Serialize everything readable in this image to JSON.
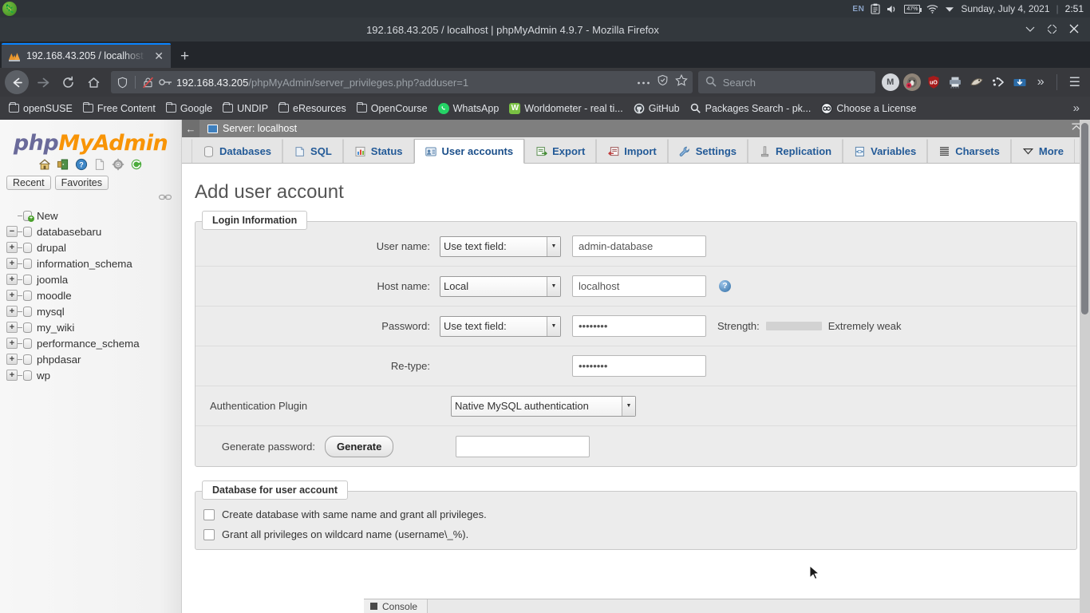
{
  "os_panel": {
    "logo": "opensuse-logo",
    "tray": {
      "keyboard_language": "EN",
      "icons": [
        "clipboard-icon",
        "volume-icon",
        "battery-icon",
        "wifi-icon",
        "dropdown-arrow-icon"
      ],
      "battery_percent": "47%",
      "date": "Sunday, July 4, 2021",
      "time": "2:51"
    }
  },
  "browser": {
    "window_title": "192.168.43.205 / localhost | phpMyAdmin 4.9.7 - Mozilla Firefox",
    "window_controls": [
      "minimize",
      "maximize",
      "close"
    ],
    "tab": {
      "title": "192.168.43.205 / localhost",
      "favicon": "phpmyadmin-favicon",
      "close_label": "✕",
      "new_tab_label": "+"
    },
    "nav": {
      "back": "←",
      "forward": "→",
      "reload": "⟳",
      "home": "⌂"
    },
    "url": {
      "host": "192.168.43.205",
      "path": "/phpMyAdmin/server_privileges.php?adduser=1",
      "full": "192.168.43.205/phpMyAdmin/server_privileges.php?adduser=1",
      "icons": [
        "shield-icon",
        "insecure-lock-icon",
        "key-icon"
      ],
      "trailing_icons": [
        "page-actions-ellipsis-icon",
        "reader-mode-icon",
        "bookmark-star-icon"
      ]
    },
    "search": {
      "placeholder": "Search",
      "icon": "search-icon"
    },
    "extensions": [
      {
        "name": "momentum-extension-icon",
        "glyph": "M",
        "bg": "#d4d7dc",
        "fg": "#4a4d52"
      },
      {
        "name": "privacy-badger-icon",
        "glyph": "",
        "bg": "#8a8f96",
        "fg": "#fff"
      },
      {
        "name": "ublock-origin-icon",
        "glyph": "uO",
        "bg": "#a81b1b",
        "fg": "#fff"
      },
      {
        "name": "printer-extension-icon",
        "glyph": "",
        "bg": "#7f8b98",
        "fg": "#fff"
      },
      {
        "name": "dark-reader-icon",
        "glyph": "",
        "bg": "#6f6256",
        "fg": "#fff"
      },
      {
        "name": "colorzilla-icon",
        "glyph": "",
        "bg": "#3a3d42",
        "fg": "#dfe3e8"
      },
      {
        "name": "downthemall-icon",
        "glyph": "",
        "bg": "#2b6ca8",
        "fg": "#fff"
      }
    ],
    "overflow_label": "»",
    "menu_label": "☰",
    "bookmarks": [
      {
        "label": "openSUSE",
        "icon": "folder-icon"
      },
      {
        "label": "Free Content",
        "icon": "folder-icon"
      },
      {
        "label": "Google",
        "icon": "folder-icon"
      },
      {
        "label": "UNDIP",
        "icon": "folder-icon"
      },
      {
        "label": "eResources",
        "icon": "folder-icon"
      },
      {
        "label": "OpenCourse",
        "icon": "folder-icon"
      },
      {
        "label": "WhatsApp",
        "icon": "whatsapp-icon",
        "color": "#25d366"
      },
      {
        "label": "Worldometer - real ti...",
        "icon": "worldometer-icon",
        "color": "#7ac143"
      },
      {
        "label": "GitHub",
        "icon": "github-icon",
        "color": "#d9dde1"
      },
      {
        "label": "Packages Search - pk...",
        "icon": "search-icon",
        "color": "transparent"
      },
      {
        "label": "Choose a License",
        "icon": "creative-commons-icon",
        "color": "#f2f4f6"
      }
    ],
    "bookmarks_overflow": "»"
  },
  "phpmyadmin": {
    "logo": {
      "part1": "php",
      "part2": "MyAdmin"
    },
    "sidebar_icons": [
      "home-icon",
      "server-logout-icon",
      "documentation-icon",
      "sql-doc-icon",
      "settings-gear-icon",
      "refresh-icon"
    ],
    "quicklinks": [
      "Recent",
      "Favorites"
    ],
    "databases": [
      {
        "label": "New",
        "toggle": "",
        "new": true
      },
      {
        "label": "databasebaru",
        "toggle": "−"
      },
      {
        "label": "drupal",
        "toggle": "+"
      },
      {
        "label": "information_schema",
        "toggle": "+"
      },
      {
        "label": "joomla",
        "toggle": "+"
      },
      {
        "label": "moodle",
        "toggle": "+"
      },
      {
        "label": "mysql",
        "toggle": "+"
      },
      {
        "label": "my_wiki",
        "toggle": "+"
      },
      {
        "label": "performance_schema",
        "toggle": "+"
      },
      {
        "label": "phpdasar",
        "toggle": "+"
      },
      {
        "label": "wp",
        "toggle": "+"
      }
    ],
    "server_bar": {
      "collapse_icon": "←",
      "label": "Server: localhost",
      "icon": "server-icon",
      "top_collapse_icon": "⤒"
    },
    "tabs": [
      {
        "label": "Databases",
        "icon": "database-icon",
        "active": false
      },
      {
        "label": "SQL",
        "icon": "sql-icon",
        "active": false
      },
      {
        "label": "Status",
        "icon": "status-chart-icon",
        "active": false
      },
      {
        "label": "User accounts",
        "icon": "user-accounts-icon",
        "active": true
      },
      {
        "label": "Export",
        "icon": "export-icon",
        "active": false
      },
      {
        "label": "Import",
        "icon": "import-icon",
        "active": false
      },
      {
        "label": "Settings",
        "icon": "wrench-icon",
        "active": false
      },
      {
        "label": "Replication",
        "icon": "replication-icon",
        "active": false
      },
      {
        "label": "Variables",
        "icon": "variables-icon",
        "active": false
      },
      {
        "label": "Charsets",
        "icon": "charsets-icon",
        "active": false
      },
      {
        "label": "More",
        "icon": "chevron-down-icon",
        "active": false
      }
    ],
    "page_title": "Add user account",
    "login_information": {
      "legend": "Login Information",
      "rows": {
        "username": {
          "label": "User name:",
          "select_value": "Use text field:",
          "input_value": "admin-database"
        },
        "hostname": {
          "label": "Host name:",
          "select_value": "Local",
          "input_value": "localhost",
          "help_icon": "help-icon"
        },
        "password": {
          "label": "Password:",
          "select_value": "Use text field:",
          "input_value": "••••••••",
          "strength_label": "Strength:",
          "strength_value": "Extremely weak"
        },
        "retype": {
          "label": "Re-type:",
          "input_value": "••••••••"
        },
        "auth_plugin": {
          "label": "Authentication Plugin",
          "select_value": "Native MySQL authentication"
        },
        "generate_password": {
          "label": "Generate password:",
          "button_label": "Generate",
          "input_value": ""
        }
      }
    },
    "database_for_user": {
      "legend": "Database for user account",
      "checkboxes": [
        {
          "label": "Create database with same name and grant all privileges.",
          "checked": false
        },
        {
          "label": "Grant all privileges on wildcard name (username\\_%).",
          "checked": false
        }
      ]
    },
    "console": {
      "label": "Console",
      "icon": "console-icon"
    }
  }
}
